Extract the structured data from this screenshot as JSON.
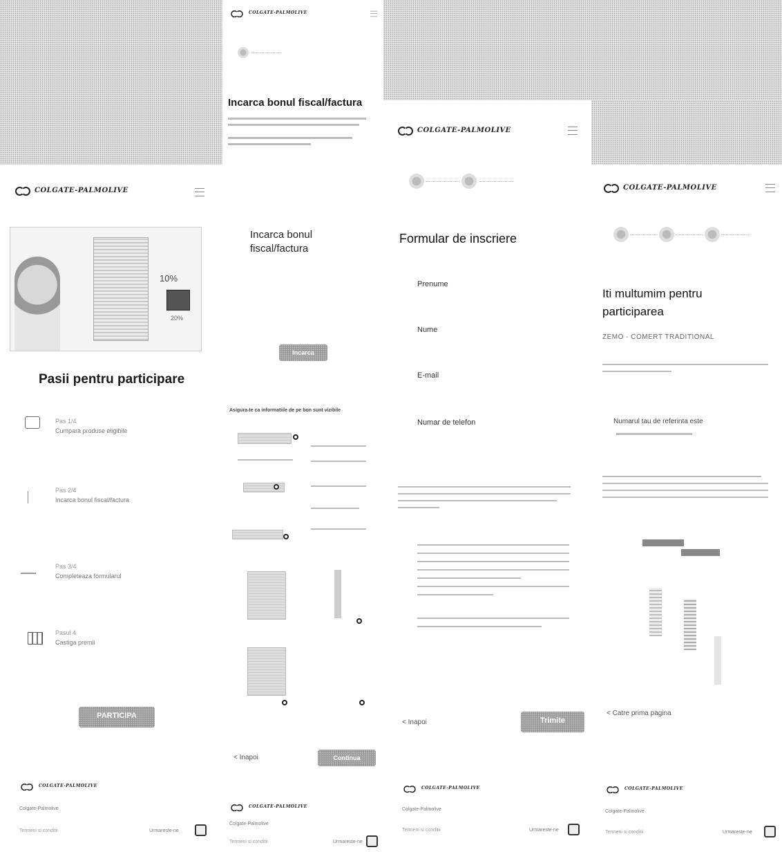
{
  "brand": {
    "name": "COLGATE-PALMOLIVE"
  },
  "colors": {
    "button": "#9a9a9a",
    "text": "#1a1a1a",
    "muted": "#888888",
    "background": "#ffffff"
  },
  "icons": [
    "menu-icon",
    "colgate-logo-icon",
    "social-icon",
    "gift-icon",
    "receipt-icon",
    "cart-icon",
    "back-arrow-icon"
  ],
  "screen_steps": {
    "hero_badge": "10%",
    "hero_badge2": "20%",
    "title": "Pasii pentru participare",
    "steps": [
      {
        "number": "Pas 1/4",
        "text": "Cumpara produse eligibile"
      },
      {
        "number": "Pas 2/4",
        "text": "Incarca bonul fiscal/factura"
      },
      {
        "number": "Pas 3/4",
        "text": "Completeaza formularul"
      },
      {
        "number": "Pasul 4",
        "text": "Castiga premii"
      }
    ],
    "cta": "PARTICIPA"
  },
  "screen_upload": {
    "top_title": "Incarca bonul fiscal/factura",
    "mid_title_line1": "Incarca bonul",
    "mid_title_line2": "fiscal/factura",
    "upload_button": "Incarca",
    "info_heading": "Asigura-te ca informatiile de pe bon sunt vizibile",
    "back": "< Inapoi",
    "next": "Continua"
  },
  "screen_form": {
    "title": "Formular de inscriere",
    "fields": [
      "Prenume",
      "Nume",
      "E-mail",
      "Numar de telefon"
    ],
    "back": "< Inapoi",
    "submit": "Trimite"
  },
  "screen_thanks": {
    "title_line1": "Iti multumim pentru",
    "title_line2": "participarea",
    "subtitle": "ZEMO - COMERT TRADITIONAL",
    "reference_label": "Numarul tau de referinta este",
    "home_link": "< Catre prima pagina"
  },
  "footer": {
    "copyright": "Colgate-Palmolive",
    "links": "Termeni si conditii",
    "follow": "Urmareste-ne"
  }
}
